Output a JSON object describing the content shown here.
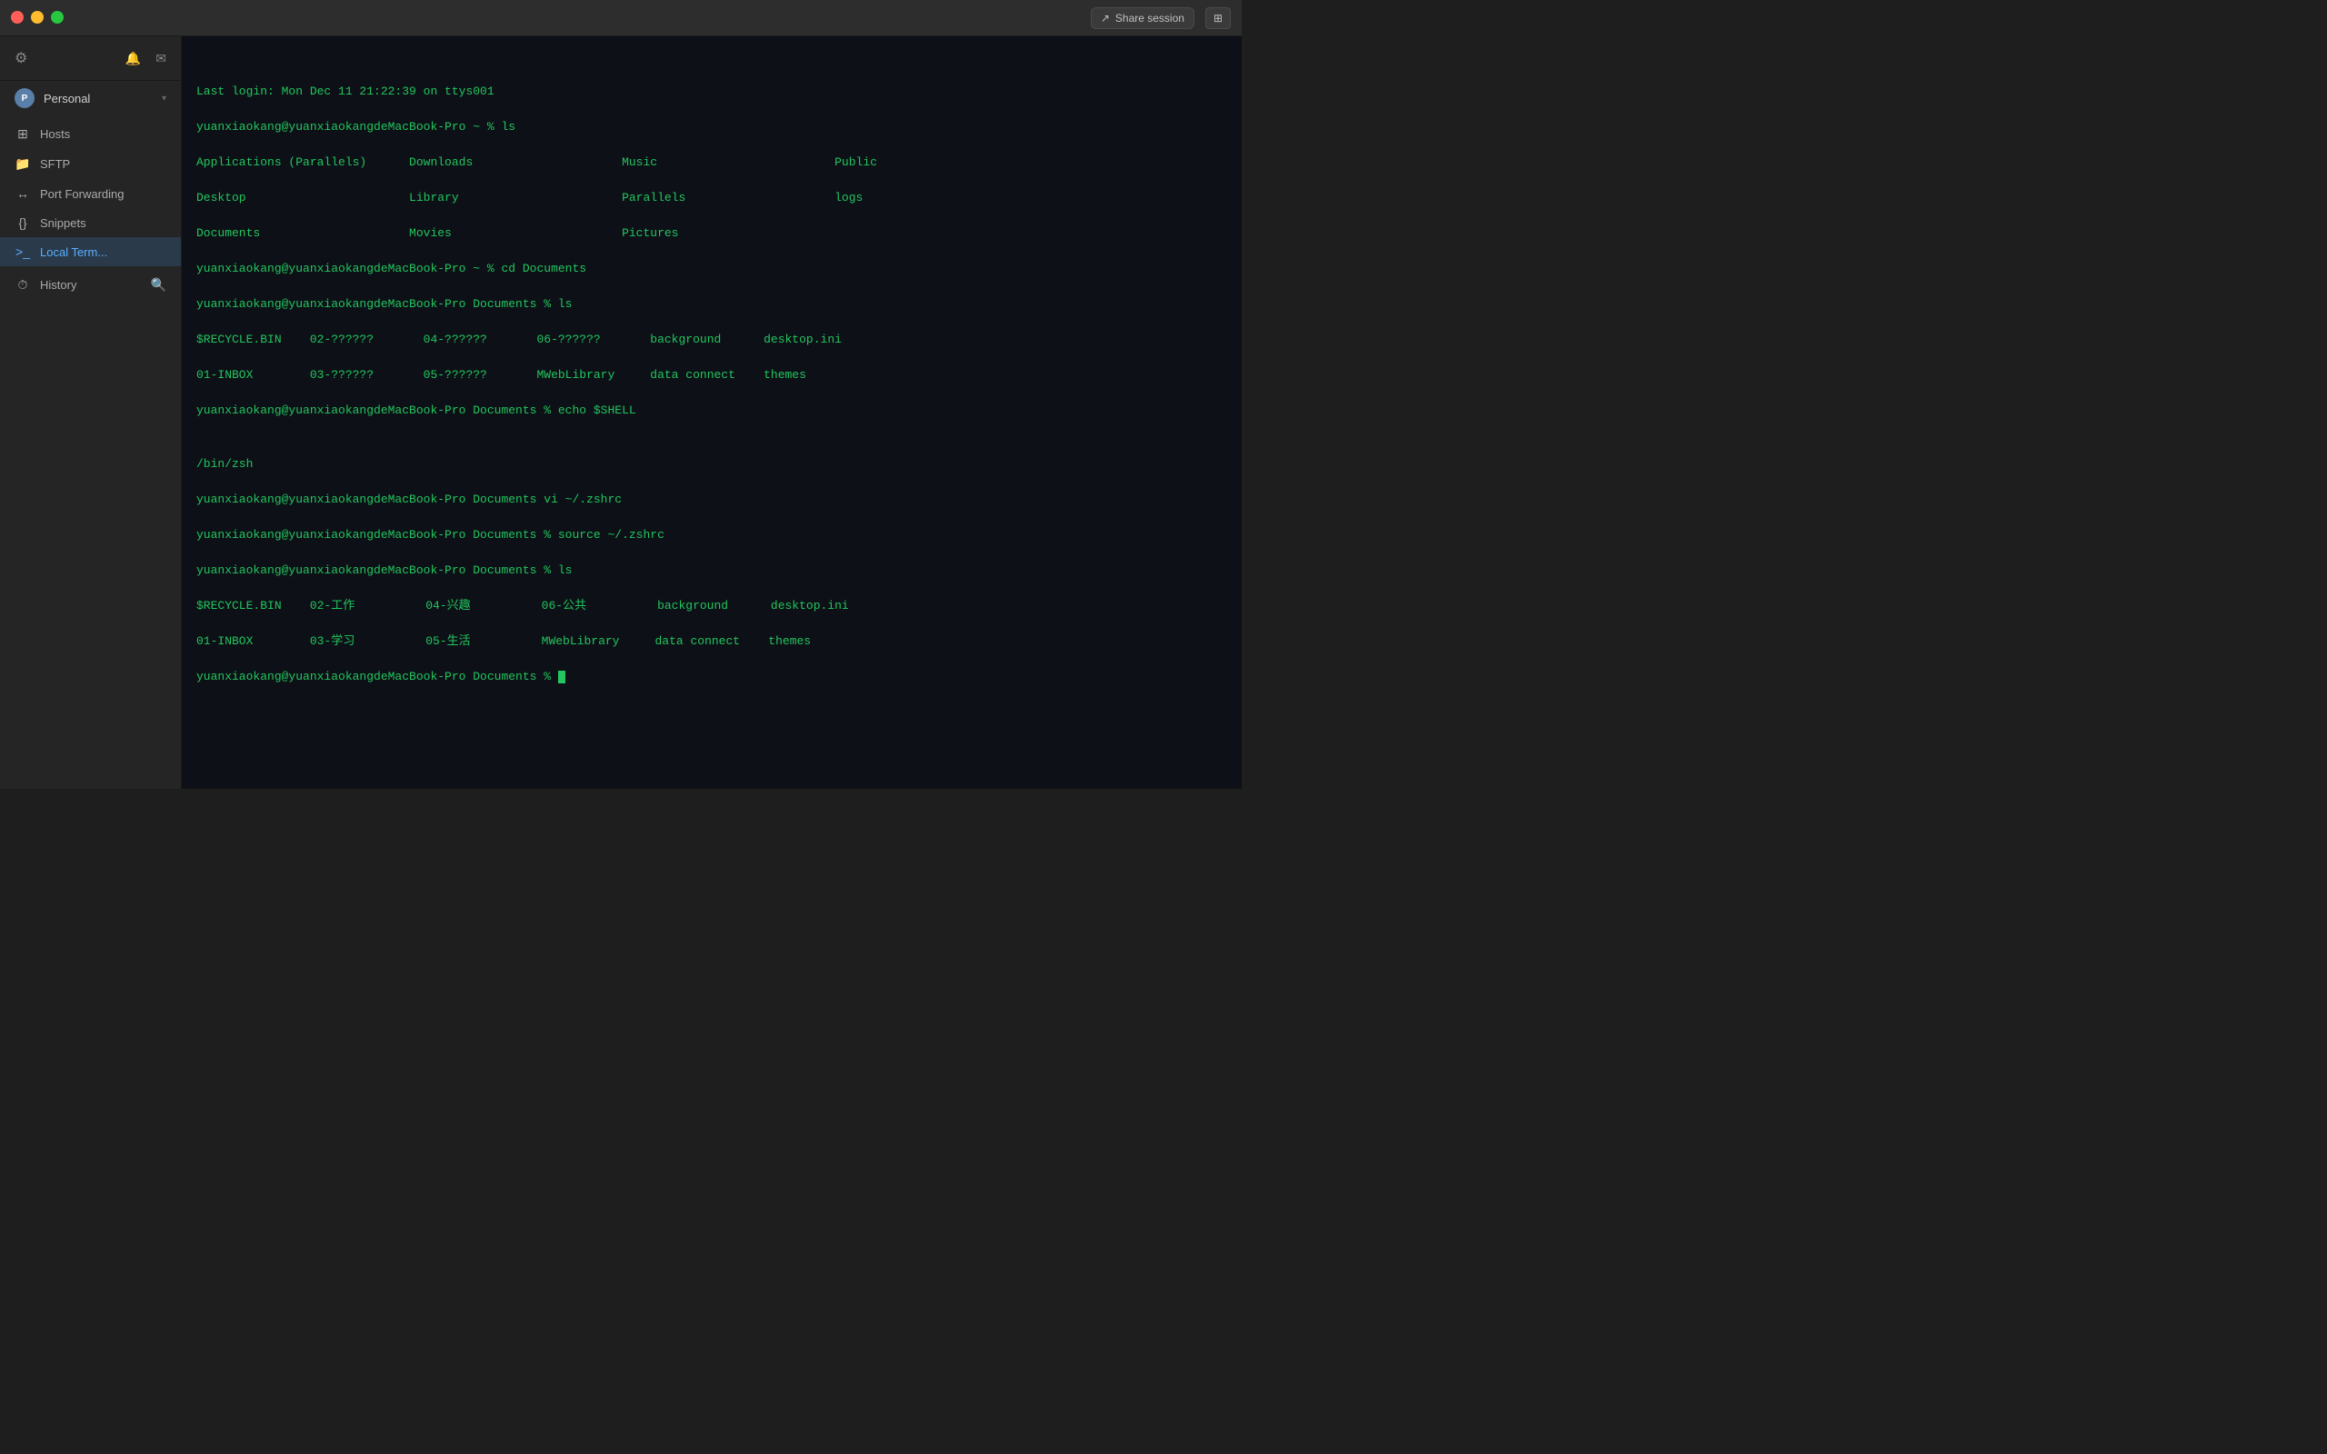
{
  "titlebar": {
    "share_session_label": "Share session",
    "layout_icon": "⊞"
  },
  "sidebar": {
    "settings_icon": "⚙",
    "notification_icon": "🔔",
    "compose_icon": "✉",
    "personal": {
      "label": "Personal",
      "chevron": "▾"
    },
    "items": [
      {
        "id": "hosts",
        "icon": "⊞",
        "label": "Hosts"
      },
      {
        "id": "sftp",
        "icon": "📁",
        "label": "SFTP"
      },
      {
        "id": "port-forwarding",
        "icon": "↔",
        "label": "Port Forwarding"
      },
      {
        "id": "snippets",
        "icon": "{}",
        "label": "Snippets"
      },
      {
        "id": "local-term",
        "icon": ">_",
        "label": "Local Term...",
        "active": true
      }
    ],
    "history": {
      "label": "History",
      "search_icon": "🔍"
    }
  },
  "terminal": {
    "lines": [
      "Last login: Mon Dec 11 21:22:39 on ttys001",
      "yuanxiaokang@yuanxiaokangdeMacBook-Pro ~ % ls",
      "Applications (Parallels)      Downloads                     Music                         Public",
      "Desktop                       Library                       Parallels                     logs",
      "Documents                     Movies                        Pictures",
      "yuanxiaokang@yuanxiaokangdeMacBook-Pro ~ % cd Documents",
      "yuanxiaokang@yuanxiaokangdeMacBook-Pro Documents % ls",
      "$RECYCLE.BIN    02-??????       04-??????       06-??????       background      desktop.ini",
      "01-INBOX        03-??????       05-??????       MWebLibrary     data connect    themes",
      "yuanxiaokang@yuanxiaokangdeMacBook-Pro Documents % echo $SHELL",
      "",
      "/bin/zsh",
      "yuanxiaokang@yuanxiaokangdeMacBook-Pro Documents vi ~/.zshrc",
      "yuanxiaokang@yuanxiaokangdeMacBook-Pro Documents % source ~/.zshrc",
      "yuanxiaokang@yuanxiaokangdeMacBook-Pro Documents % ls",
      "$RECYCLE.BIN    02-工作          04-兴趣          06-公共          background      desktop.ini",
      "01-INBOX        03-学习          05-生活          MWebLibrary     data connect    themes",
      "yuanxiaokang@yuanxiaokangdeMacBook-Pro Documents % "
    ]
  }
}
